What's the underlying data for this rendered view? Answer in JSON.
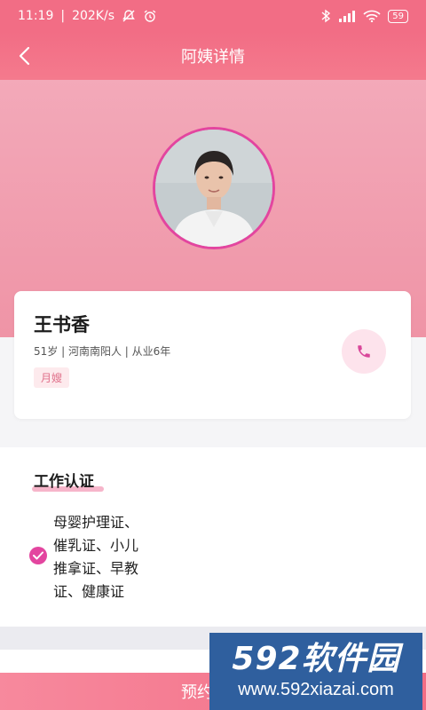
{
  "status_bar": {
    "time": "11:19",
    "speed": "202K/s",
    "battery": "59"
  },
  "nav": {
    "title": "阿姨详情"
  },
  "profile": {
    "name": "王书香",
    "meta": "51岁 | 河南南阳人 | 从业6年",
    "tag": "月嫂"
  },
  "certification": {
    "title": "工作认证",
    "items": "母婴护理证、催乳证、小儿推拿证、早教证、健康证"
  },
  "bottom_button": {
    "label": "预约面试"
  },
  "watermark": {
    "logo": "592软件园",
    "url": "www.592xiazai.com"
  },
  "colors": {
    "accent": "#f26d85",
    "magenta": "#e3459f"
  }
}
